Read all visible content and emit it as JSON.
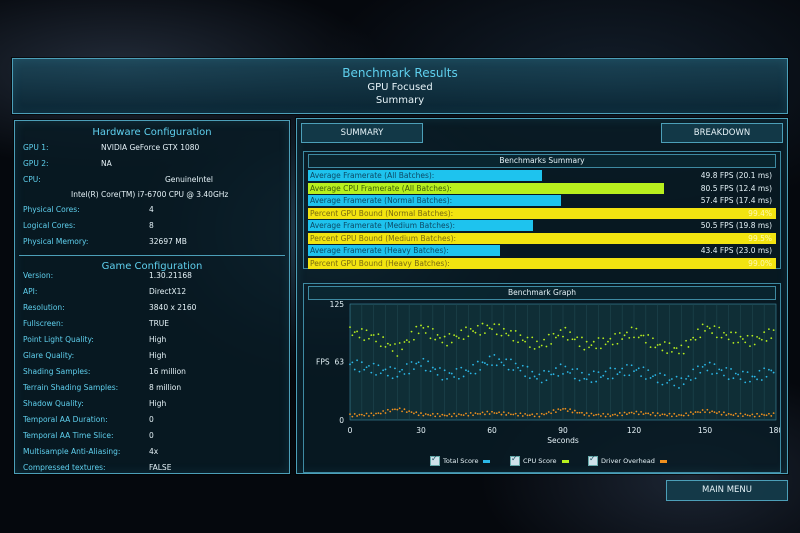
{
  "header": {
    "title": "Benchmark Results",
    "subtitle": "GPU Focused",
    "subsubtitle": "Summary"
  },
  "hardware": {
    "title": "Hardware Configuration",
    "rows": [
      {
        "label": "GPU 1:",
        "value": "NVIDIA GeForce GTX 1080"
      },
      {
        "label": "GPU 2:",
        "value": "NA"
      },
      {
        "label": "CPU:",
        "value": "GenuineIntel"
      },
      {
        "label": "",
        "value": "Intel(R) Core(TM) i7-6700 CPU @ 3.40GHz"
      },
      {
        "label": "Physical Cores:",
        "value": "4"
      },
      {
        "label": "Logical Cores:",
        "value": "8"
      },
      {
        "label": "Physical Memory:",
        "value": "32697 MB"
      }
    ]
  },
  "game": {
    "title": "Game Configuration",
    "rows": [
      {
        "label": "Version:",
        "value": "1.30.21168"
      },
      {
        "label": "API:",
        "value": "DirectX12"
      },
      {
        "label": "Resolution:",
        "value": "3840 x 2160"
      },
      {
        "label": "Fullscreen:",
        "value": "TRUE"
      },
      {
        "label": "Point Light Quality:",
        "value": "High"
      },
      {
        "label": "Glare Quality:",
        "value": "High"
      },
      {
        "label": "Shading Samples:",
        "value": "16 million"
      },
      {
        "label": "Terrain Shading Samples:",
        "value": "8 million"
      },
      {
        "label": "Shadow Quality:",
        "value": "High"
      },
      {
        "label": "Temporal AA Duration:",
        "value": "0"
      },
      {
        "label": "Temporal AA Time Slice:",
        "value": "0"
      },
      {
        "label": "Multisample Anti-Aliasing:",
        "value": "4x"
      },
      {
        "label": "Compressed textures:",
        "value": "FALSE"
      }
    ]
  },
  "tabs": {
    "summary": "SUMMARY",
    "breakdown": "BREAKDOWN"
  },
  "summary": {
    "title": "Benchmarks Summary",
    "colors": {
      "average": "#1ec3ee",
      "cpu": "#b8f01e",
      "percent": "#f2e410"
    },
    "rows": [
      {
        "label": "Average Framerate (All Batches):",
        "value": "49.8 FPS (20.1 ms)",
        "fraction": 0.5,
        "kind": "average"
      },
      {
        "label": "Average CPU Framerate (All Batches):",
        "value": "80.5 FPS (12.4 ms)",
        "fraction": 0.76,
        "kind": "cpu"
      },
      {
        "label": "Average Framerate (Normal Batches):",
        "value": "57.4 FPS (17.4 ms)",
        "fraction": 0.54,
        "kind": "average"
      },
      {
        "label": "Percent GPU Bound (Normal Batches):",
        "value": "99.4%",
        "fraction": 1.0,
        "kind": "percent"
      },
      {
        "label": "Average Framerate (Medium Batches):",
        "value": "50.5 FPS (19.8 ms)",
        "fraction": 0.48,
        "kind": "average"
      },
      {
        "label": "Percent GPU Bound (Medium Batches):",
        "value": "99.5%",
        "fraction": 1.0,
        "kind": "percent"
      },
      {
        "label": "Average Framerate (Heavy Batches):",
        "value": "43.4 FPS (23.0 ms)",
        "fraction": 0.41,
        "kind": "average"
      },
      {
        "label": "Percent GPU Bound (Heavy Batches):",
        "value": "99.0%",
        "fraction": 1.0,
        "kind": "percent"
      }
    ]
  },
  "graph": {
    "title": "Benchmark Graph",
    "ylabel": "FPS",
    "xlabel": "Seconds",
    "legend": [
      {
        "label": "Total Score",
        "color": "#2bb8e8"
      },
      {
        "label": "CPU Score",
        "color": "#b8f01e"
      },
      {
        "label": "Driver Overhead",
        "color": "#f0901e"
      }
    ]
  },
  "chart_data": {
    "type": "scatter",
    "xlabel": "Seconds",
    "ylabel": "FPS",
    "xlim": [
      0,
      180
    ],
    "ylim": [
      0,
      125
    ],
    "xticks": [
      0,
      30,
      60,
      90,
      120,
      150,
      180
    ],
    "yticks": [
      0,
      63,
      125
    ],
    "series": [
      {
        "name": "Total Score",
        "x": [
          0,
          10,
          20,
          30,
          40,
          50,
          60,
          70,
          80,
          90,
          100,
          110,
          120,
          130,
          140,
          150,
          160,
          170,
          180
        ],
        "y": [
          60,
          55,
          50,
          62,
          48,
          52,
          65,
          58,
          45,
          55,
          45,
          50,
          55,
          45,
          40,
          58,
          50,
          45,
          55
        ]
      },
      {
        "name": "CPU Score",
        "x": [
          0,
          10,
          20,
          30,
          40,
          50,
          60,
          70,
          80,
          90,
          100,
          110,
          120,
          130,
          140,
          150,
          160,
          170,
          180
        ],
        "y": [
          95,
          90,
          75,
          100,
          85,
          95,
          100,
          90,
          80,
          95,
          80,
          85,
          95,
          80,
          75,
          100,
          90,
          85,
          95
        ]
      },
      {
        "name": "Driver Overhead",
        "x": [
          0,
          10,
          20,
          30,
          40,
          50,
          60,
          70,
          80,
          90,
          100,
          110,
          120,
          130,
          140,
          150,
          160,
          170,
          180
        ],
        "y": [
          5,
          6,
          12,
          6,
          5,
          6,
          8,
          6,
          5,
          12,
          6,
          5,
          8,
          6,
          5,
          10,
          6,
          5,
          6
        ]
      }
    ]
  },
  "footer": {
    "main_menu": "MAIN MENU"
  }
}
